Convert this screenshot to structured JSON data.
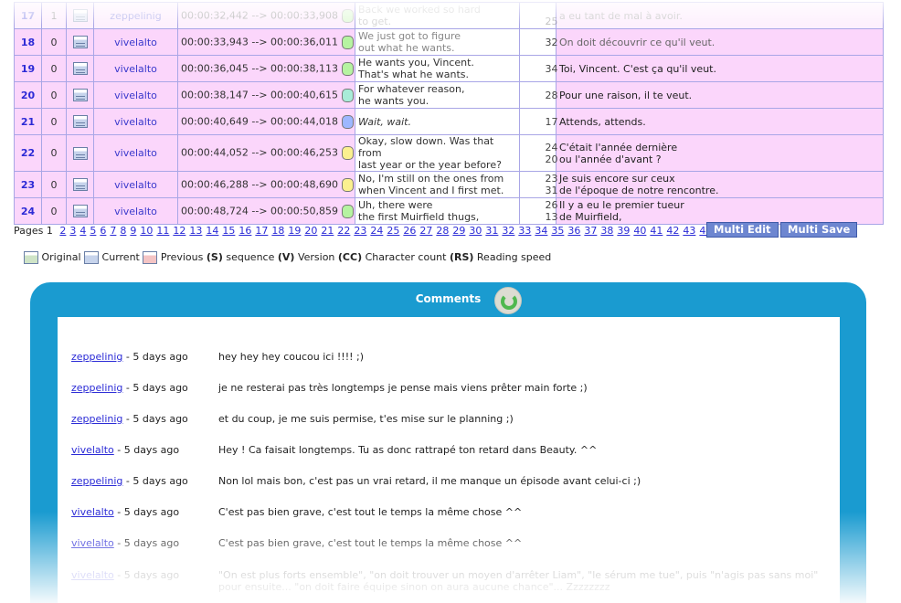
{
  "rows": [
    {
      "num": "17",
      "ver": "1",
      "user": "zeppelinig",
      "time": "00:00:32,442 --> 00:00:33,908",
      "dot": "green",
      "orig": [
        "Back we worked so hard",
        "to get."
      ],
      "cc": [
        "",
        "25"
      ],
      "tr": [
        "a eu tant de mal à avoir."
      ]
    },
    {
      "num": "18",
      "ver": "0",
      "user": "vivelalto",
      "time": "00:00:33,943 --> 00:00:36,011",
      "dot": "green",
      "orig": [
        "We just got to figure",
        "out what he wants."
      ],
      "cc": [
        "32"
      ],
      "tr": [
        "On doit découvrir ce qu'il veut."
      ]
    },
    {
      "num": "19",
      "ver": "0",
      "user": "vivelalto",
      "time": "00:00:36,045 --> 00:00:38,113",
      "dot": "green",
      "orig": [
        "He wants you, Vincent.",
        "That's what he wants."
      ],
      "cc": [
        "34"
      ],
      "tr": [
        "Toi, Vincent. C'est ça qu'il veut."
      ]
    },
    {
      "num": "20",
      "ver": "0",
      "user": "vivelalto",
      "time": "00:00:38,147 --> 00:00:40,615",
      "dot": "cyan",
      "orig": [
        "For whatever reason,",
        "he wants you."
      ],
      "cc": [
        "28"
      ],
      "tr": [
        "Pour une raison, il te veut."
      ]
    },
    {
      "num": "21",
      "ver": "0",
      "user": "vivelalto",
      "time": "00:00:40,649 --> 00:00:44,018",
      "dot": "blue",
      "orig": [
        "Wait, wait."
      ],
      "cc": [
        "17"
      ],
      "tr": [
        "Attends, attends."
      ]
    },
    {
      "num": "22",
      "ver": "0",
      "user": "vivelalto",
      "time": "00:00:44,052 --> 00:00:46,253",
      "dot": "yellow",
      "orig": [
        "Okay, slow down. Was that from",
        "last year or the year before?"
      ],
      "cc": [
        "24",
        "20"
      ],
      "tr": [
        "C'était l'année dernière",
        "ou l'année d'avant ?"
      ]
    },
    {
      "num": "23",
      "ver": "0",
      "user": "vivelalto",
      "time": "00:00:46,288 --> 00:00:48,690",
      "dot": "yellow",
      "orig": [
        "No, I'm still on the ones from",
        "when Vincent and I first met."
      ],
      "cc": [
        "23",
        "31"
      ],
      "tr": [
        "Je suis encore sur ceux",
        "de l'époque de notre rencontre."
      ]
    },
    {
      "num": "24",
      "ver": "0",
      "user": "vivelalto",
      "time": "00:00:48,724 --> 00:00:50,859",
      "dot": "green",
      "orig": [
        "Uh, there were",
        "the first Muirfield thugs,"
      ],
      "cc": [
        "26",
        "13"
      ],
      "tr": [
        "Il y a eu le premier tueur",
        "de Muirfield,"
      ]
    }
  ],
  "pager": {
    "label": "Pages",
    "current": "1",
    "pages": [
      "2",
      "3",
      "4",
      "5",
      "6",
      "7",
      "8",
      "9",
      "10",
      "11",
      "12",
      "13",
      "14",
      "15",
      "16",
      "17",
      "18",
      "19",
      "20",
      "21",
      "22",
      "23",
      "24",
      "25",
      "26",
      "27",
      "28",
      "29",
      "30",
      "31",
      "32",
      "33",
      "34",
      "35",
      "36",
      "37",
      "38",
      "39",
      "40",
      "41",
      "42",
      "43",
      "44",
      "45",
      "46"
    ]
  },
  "buttons": {
    "multi_edit": "Multi Edit",
    "multi_save": "Multi Save"
  },
  "legend": {
    "original": "Original",
    "current": "Current",
    "previous": "Previous",
    "s_key": "(S)",
    "s_label": "sequence",
    "v_key": "(V)",
    "v_label": "Version",
    "cc_key": "(CC)",
    "cc_label": "Character count",
    "rs_key": "(RS)",
    "rs_label": "Reading speed"
  },
  "comments_panel": {
    "title": "Comments",
    "items": [
      {
        "user": "zeppelinig",
        "age": "- 5 days ago",
        "text": "hey hey hey coucou ici !!!! ;)"
      },
      {
        "user": "zeppelinig",
        "age": "- 5 days ago",
        "text": "je ne resterai pas très longtemps je pense mais viens prêter main forte ;)"
      },
      {
        "user": "zeppelinig",
        "age": "- 5 days ago",
        "text": "et du coup, je me suis permise, t'es mise sur le planning ;)"
      },
      {
        "user": "vivelalto",
        "age": "- 5 days ago",
        "text": "Hey ! Ca faisait longtemps. Tu as donc rattrapé ton retard dans Beauty. ^^"
      },
      {
        "user": "zeppelinig",
        "age": "- 5 days ago",
        "text": "Non lol mais bon, c'est pas un vrai retard, il me manque un épisode avant celui-ci ;)"
      },
      {
        "user": "vivelalto",
        "age": "- 5 days ago",
        "text": "C'est pas bien grave, c'est tout le temps la même chose ^^"
      },
      {
        "user": "vivelalto",
        "age": "- 5 days ago",
        "text": "C'est pas bien grave, c'est tout le temps la même chose ^^"
      },
      {
        "user": "vivelalto",
        "age": "- 5 days ago",
        "text": "\"On est plus forts ensemble\", \"on doit trouver un moyen d'arrêter Liam\", \"le sérum me tue\", puis \"n'agis pas sans moi\" pour ensuite... \"on doit faire équipe sinon on aura aucune chance\"... Zzzzzzzz"
      }
    ]
  },
  "colors": {
    "accent": "#1a9bd0",
    "row_bg": "#fbd6fb",
    "link": "#2a2ad6",
    "button": "#6d86d0"
  }
}
